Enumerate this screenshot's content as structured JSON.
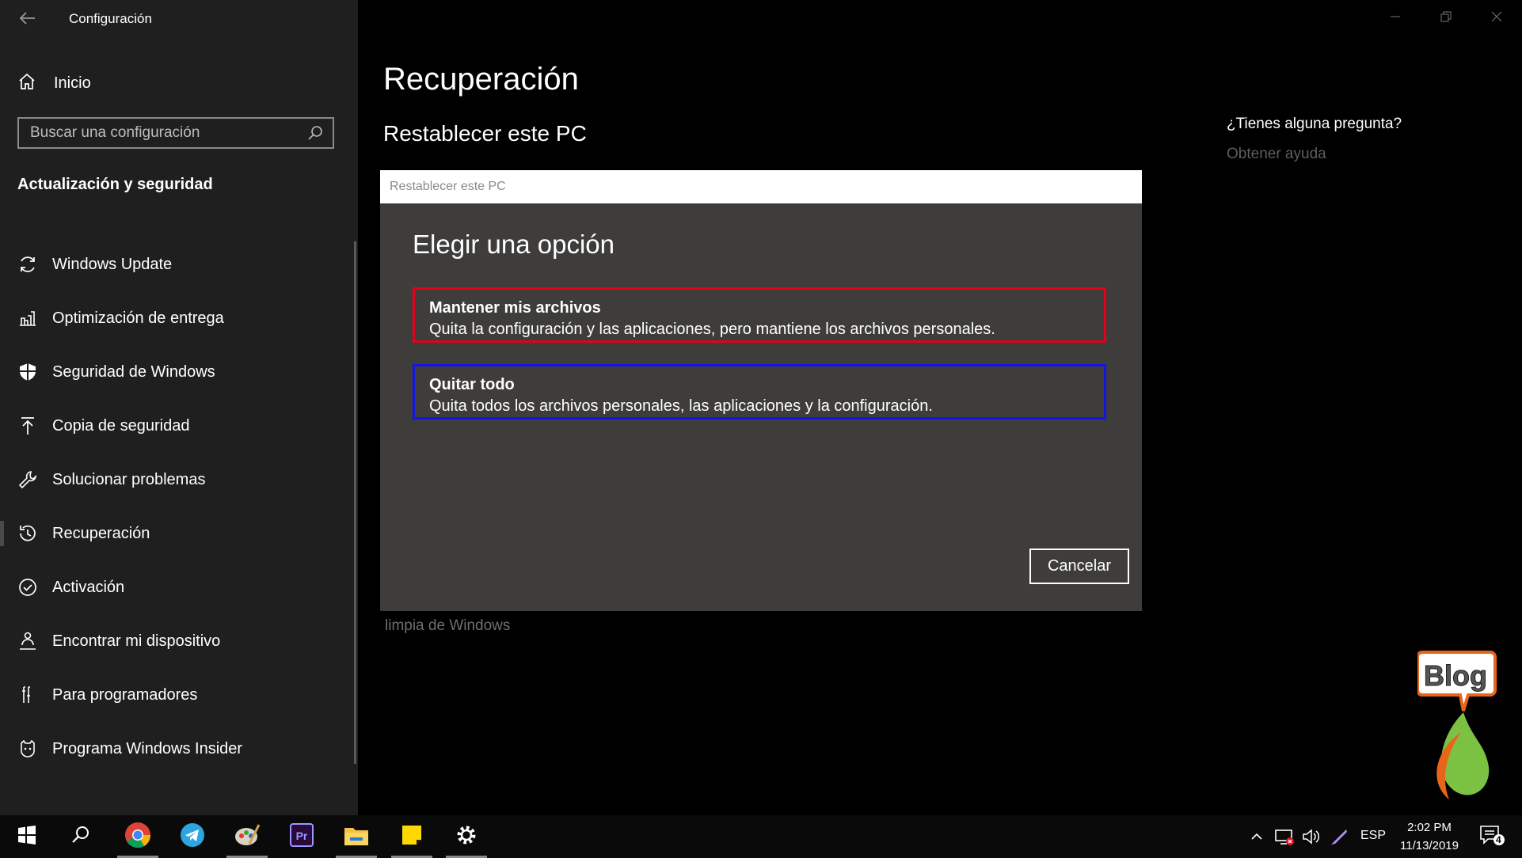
{
  "window": {
    "title": "Configuración"
  },
  "sidebar": {
    "home_label": "Inicio",
    "search_placeholder": "Buscar una configuración",
    "section_title": "Actualización y seguridad",
    "items": [
      {
        "label": "Windows Update",
        "icon": "refresh-icon"
      },
      {
        "label": "Optimización de entrega",
        "icon": "delivery-icon"
      },
      {
        "label": "Seguridad de Windows",
        "icon": "shield-icon"
      },
      {
        "label": "Copia de seguridad",
        "icon": "backup-icon"
      },
      {
        "label": "Solucionar problemas",
        "icon": "wrench-icon"
      },
      {
        "label": "Recuperación",
        "icon": "history-icon",
        "active": true
      },
      {
        "label": "Activación",
        "icon": "check-circle-icon"
      },
      {
        "label": "Encontrar mi dispositivo",
        "icon": "person-location-icon"
      },
      {
        "label": "Para programadores",
        "icon": "developer-icon"
      },
      {
        "label": "Programa Windows Insider",
        "icon": "insider-icon"
      }
    ]
  },
  "main": {
    "title": "Recuperación",
    "subtitle": "Restablecer este PC",
    "help_question": "¿Tienes alguna pregunta?",
    "help_link": "Obtener ayuda",
    "background_text": "limpia de Windows"
  },
  "dialog": {
    "title": "Restablecer este PC",
    "heading": "Elegir una opción",
    "options": [
      {
        "title": "Mantener mis archivos",
        "description": "Quita la configuración y las aplicaciones, pero mantiene los archivos personales.",
        "highlight_color": "#e3001b"
      },
      {
        "title": "Quitar todo",
        "description": "Quita todos los archivos personales, las aplicaciones y la configuración.",
        "highlight_color": "#1414e6"
      }
    ],
    "cancel_label": "Cancelar"
  },
  "logo": {
    "text": "Blog"
  },
  "taskbar": {
    "apps": [
      "start-icon",
      "search-icon",
      "chrome-icon",
      "telegram-icon",
      "paint-icon",
      "premiere-icon",
      "file-explorer-icon",
      "sticky-notes-icon",
      "settings-icon"
    ],
    "language": "ESP",
    "time": "2:02 PM",
    "date": "11/13/2019",
    "notification_count": "4"
  },
  "colors": {
    "sidebar_bg": "#1f1f1f",
    "dialog_bg": "#3e3d3b",
    "option_keep_border": "#e3001b",
    "option_remove_border": "#1414e6"
  }
}
